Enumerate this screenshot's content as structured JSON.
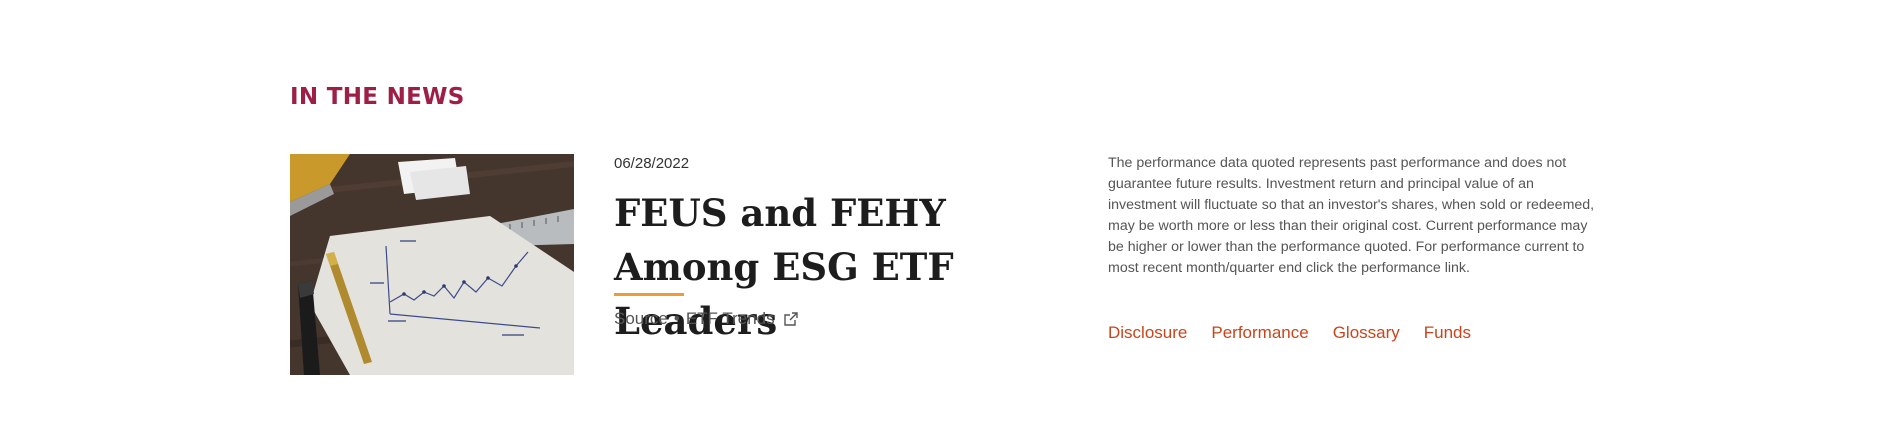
{
  "section": {
    "heading": "IN THE NEWS"
  },
  "article": {
    "image_alt": "Paper with a hand-drawn line chart beside pens and a ruler",
    "date": "06/28/2022",
    "title": "FEUS and FEHY Among ESG ETF Leaders",
    "source_label": "Source",
    "source_separator": "•",
    "source_name": "ETF Trends",
    "external_icon": "external-link-icon"
  },
  "disclaimer": {
    "text": "The performance data quoted represents past performance and does not guarantee future results. Investment return and principal value of an investment will fluctuate so that an investor's shares, when sold or redeemed, may be worth more or less than their original cost. Current performance may be higher or lower than the performance quoted. For performance current to most recent month/quarter end click the performance link."
  },
  "links": {
    "disclosure": "Disclosure",
    "performance": "Performance",
    "glossary": "Glossary",
    "funds": "Funds"
  },
  "colors": {
    "heading": "#9e1f45",
    "title": "#1d1d1d",
    "accent_underline": "#ef9a34",
    "link": "#c8451c",
    "body_text": "#555555"
  }
}
